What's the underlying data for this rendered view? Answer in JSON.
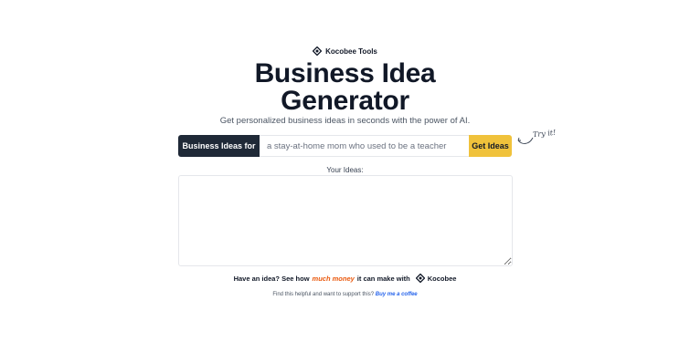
{
  "brand": {
    "name": "Kocobee Tools",
    "icon": "kocobee-logo-icon"
  },
  "hero": {
    "title_line1": "Business Idea",
    "title_line2": "Generator",
    "subtitle": "Get personalized business ideas in seconds with the power of AI."
  },
  "form": {
    "prefix_label": "Business Ideas for",
    "input_placeholder": "a stay-at-home mom who used to be a teacher",
    "input_value": "",
    "submit_label": "Get Ideas",
    "try_it": "Try it!"
  },
  "results": {
    "label": "Your Ideas:",
    "value": ""
  },
  "promo": {
    "text_before": "Have an idea? See how",
    "highlight": "much money",
    "text_after": "it can make with",
    "brand": "Kocobee"
  },
  "support": {
    "text": "Find this helpful and want to support this?",
    "link": "Buy me a coffee"
  },
  "colors": {
    "dark": "#1f2937",
    "accent_yellow": "#f0c23b",
    "highlight_orange": "#ea580c",
    "link_blue": "#2563eb"
  }
}
